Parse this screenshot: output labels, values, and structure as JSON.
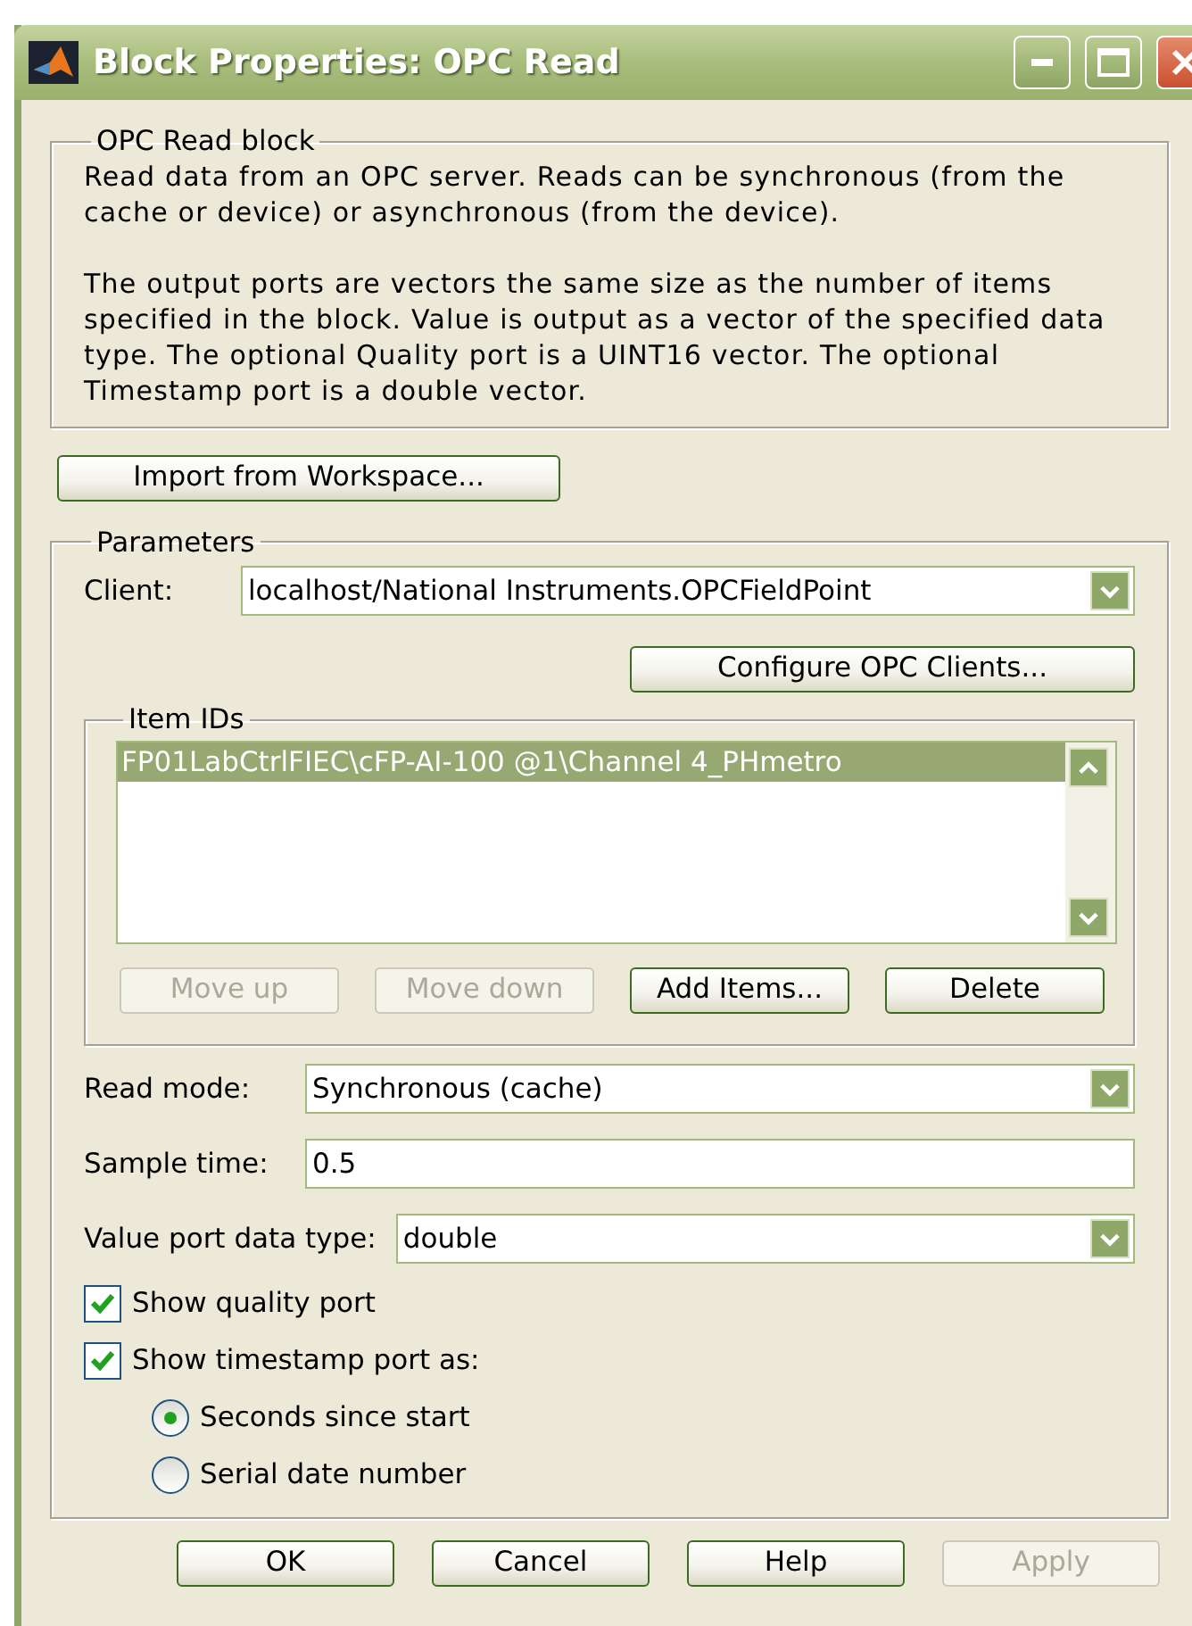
{
  "window": {
    "title": "Block Properties: OPC Read"
  },
  "description": {
    "legend": "OPC Read block",
    "paragraphs": [
      "Read data from an OPC server. Reads can be synchronous (from the cache or device) or asynchronous (from the device).",
      "The output ports are vectors the same size as the number of items specified in the block. Value is output as a vector of the specified data type. The optional Quality port is a UINT16 vector. The optional Timestamp port is a double vector."
    ]
  },
  "import_button": {
    "label": "Import from Workspace...",
    "disabled": false
  },
  "parameters": {
    "legend": "Parameters",
    "client": {
      "label": "Client:",
      "value": "localhost/National Instruments.OPCFieldPoint"
    },
    "configure_button": {
      "label": "Configure OPC Clients...",
      "disabled": false
    },
    "item_ids": {
      "legend": "Item IDs",
      "items": [
        {
          "text": "FP01LabCtrlFIEC\\cFP-AI-100 @1\\Channel 4_PHmetro",
          "selected": true
        }
      ],
      "buttons": [
        {
          "label": "Move up",
          "disabled": true
        },
        {
          "label": "Move down",
          "disabled": true
        },
        {
          "label": "Add Items...",
          "disabled": false
        },
        {
          "label": "Delete",
          "disabled": false
        }
      ]
    },
    "fields": [
      {
        "kind": "dropdown",
        "label": "Read mode:",
        "value": "Synchronous (cache)"
      },
      {
        "kind": "text",
        "label": "Sample time:",
        "value": "0.5"
      },
      {
        "kind": "dropdown",
        "label": "Value port data type:",
        "value": "double"
      }
    ],
    "options": [
      {
        "kind": "checkbox",
        "label": "Show quality port",
        "checked": true
      },
      {
        "kind": "checkbox",
        "label": "Show timestamp port as:",
        "checked": true
      },
      {
        "kind": "radio",
        "label": "Seconds since start",
        "selected": true
      },
      {
        "kind": "radio",
        "label": "Serial date number",
        "selected": false
      }
    ]
  },
  "buttons": [
    {
      "label": "OK",
      "disabled": false
    },
    {
      "label": "Cancel",
      "disabled": false
    },
    {
      "label": "Help",
      "disabled": false
    },
    {
      "label": "Apply",
      "disabled": true
    }
  ]
}
